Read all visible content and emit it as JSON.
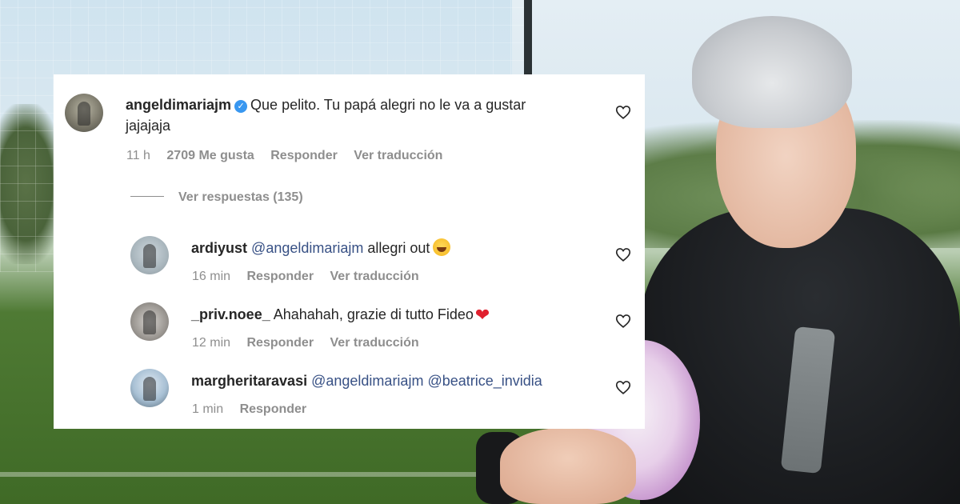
{
  "comments": [
    {
      "user": "angeldimariajm",
      "verified": true,
      "text_line1": "Que pelito. Tu papá alegri no le va a gustar",
      "text_line2": "jajajaja",
      "time": "11 h",
      "likes": "2709 Me gusta",
      "reply": "Responder",
      "translate": "Ver traducción"
    }
  ],
  "view_replies": "Ver respuestas (135)",
  "replies": [
    {
      "user": "ardiyust",
      "mention": "@angeldimariajm",
      "text": "allegri out",
      "emoji": "grinning-squinting-face",
      "time": "16 min",
      "reply": "Responder",
      "translate": "Ver traducción"
    },
    {
      "user": "_priv.noee_",
      "text": "Ahahahah, grazie di tutto Fideo",
      "emoji": "red-heart",
      "heart_glyph": "❤",
      "time": "12 min",
      "reply": "Responder",
      "translate": "Ver traducción"
    },
    {
      "user": "margheritaravasi",
      "mention": "@angeldimariajm",
      "mention2": "@beatrice_invidia",
      "time": "1 min",
      "reply": "Responder"
    }
  ],
  "icons": {
    "like": "heart-outline-icon",
    "verified": "verified-badge-icon"
  },
  "colors": {
    "username": "#262626",
    "mention": "#385185",
    "meta": "#8e8e8e",
    "verified": "#3897f0",
    "heart_emoji": "#e0202e"
  }
}
